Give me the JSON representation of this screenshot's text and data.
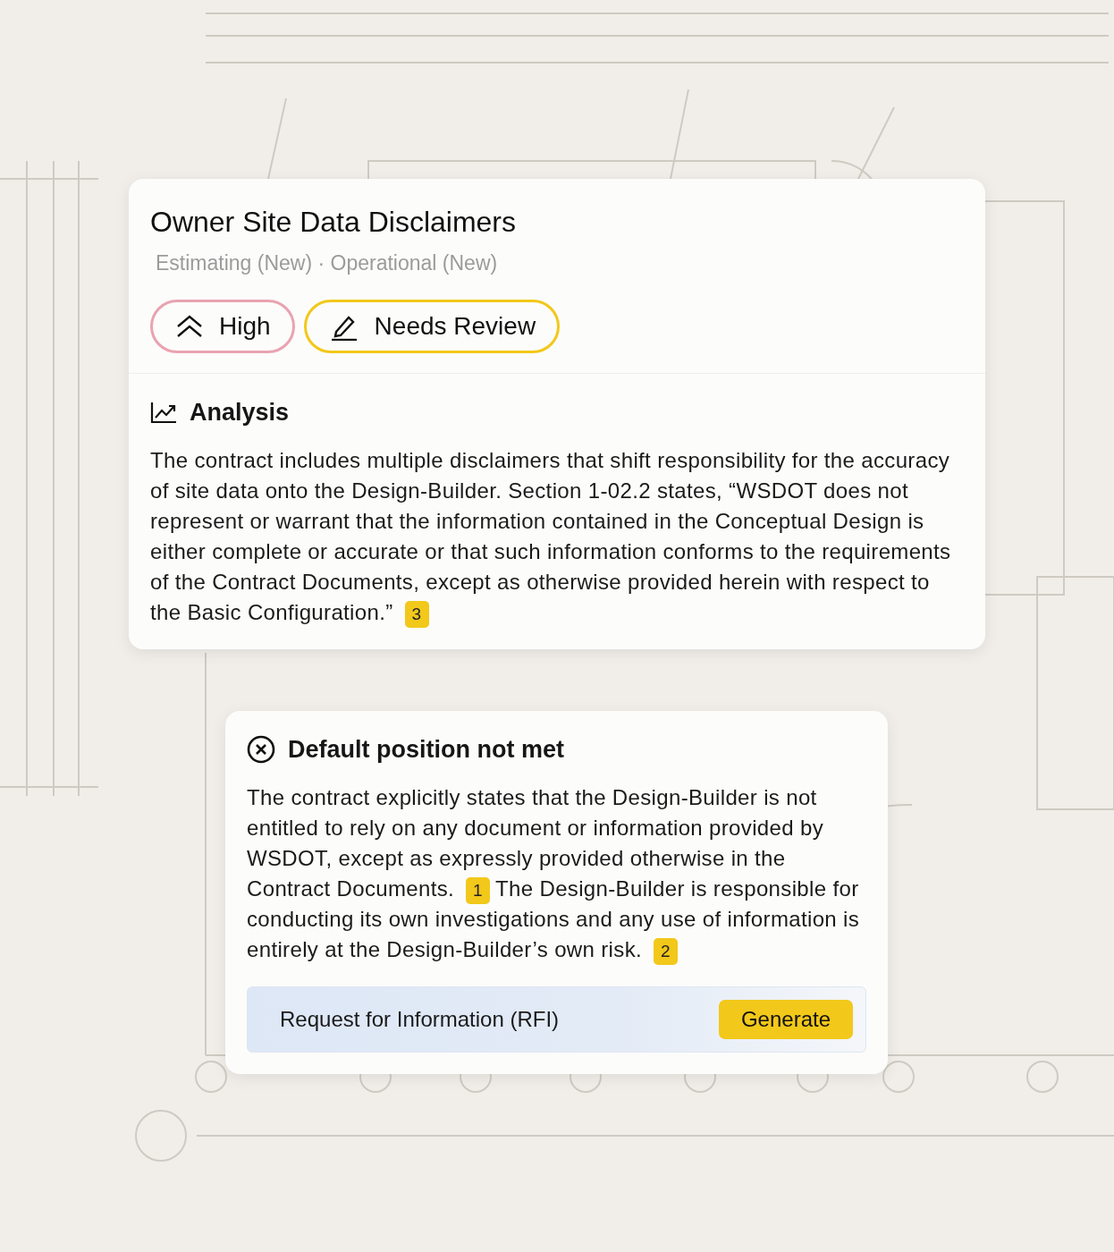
{
  "finding": {
    "title": "Owner Site Data Disclaimers",
    "subtitle": "Estimating (New) · Operational (New)",
    "badges": [
      {
        "kind": "priority",
        "label": "High",
        "color": "#e9a3b0"
      },
      {
        "kind": "status",
        "label": "Needs Review",
        "color": "#f2c81a"
      }
    ],
    "analysis": {
      "heading": "Analysis",
      "paragraph": [
        {
          "kind": "text",
          "text": "The contract includes multiple disclaimers that shift responsibility for the accuracy of site data onto the Design-Builder. Section 1-02.2 states, “WSDOT does not represent or warrant that the information contained in the Conceptual Design is either complete or accurate or that such information conforms to the requirements of the Contract Documents, except as otherwise provided herein with respect to the Basic Configuration.”"
        },
        {
          "kind": "citation",
          "text": "3"
        }
      ]
    }
  },
  "result": {
    "kind": "fail",
    "heading": "Default position not met",
    "paragraph": [
      {
        "kind": "text",
        "text": "The contract explicitly states that the Design-Builder is not entitled to rely on any document or information provided by WSDOT, except as expressly provided otherwise in the Contract Documents."
      },
      {
        "kind": "citation",
        "text": "1"
      },
      {
        "kind": "text",
        "text": "The Design-Builder is responsible for conducting its own investigations and any use of information is entirely at the Design-Builder’s own risk."
      },
      {
        "kind": "citation",
        "text": "2"
      }
    ],
    "action": {
      "label": "Request for Information (RFI)",
      "button": "Generate"
    }
  }
}
